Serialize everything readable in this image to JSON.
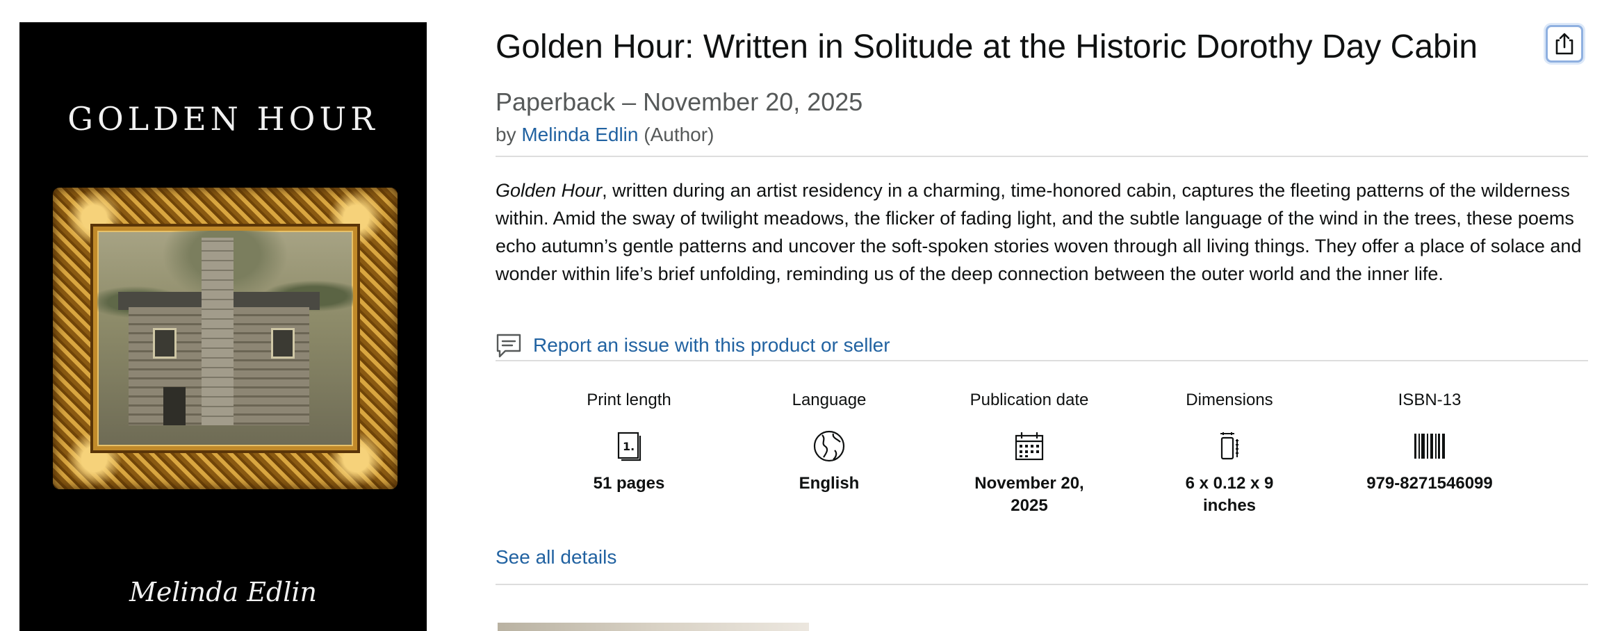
{
  "cover": {
    "title": "GOLDEN HOUR",
    "author_signature": "Melinda Edlin"
  },
  "product": {
    "title": "Golden Hour: Written in Solitude at the Historic Dorothy Day Cabin",
    "format": "Paperback – November 20, 2025",
    "by_prefix": "by ",
    "author_name": "Melinda Edlin",
    "author_role": " (Author)",
    "description_italic": "Golden Hour",
    "description_rest": ", written during an artist residency in a charming, time-honored cabin, captures the fleeting patterns of the wilderness within. Amid the sway of twilight meadows, the flicker of fading light, and the subtle language of the wind in the trees, these poems echo autumn’s gentle patterns and uncover the soft-spoken stories woven through all living things. They offer a place of solace and wonder within life’s brief unfolding, reminding us of the deep connection between the outer world and the inner life.",
    "report_link": "Report an issue with this product or seller",
    "see_all_details": "See all details"
  },
  "details": [
    {
      "label": "Print length",
      "icon": "book-pages-icon",
      "value": "51 pages"
    },
    {
      "label": "Language",
      "icon": "globe-icon",
      "value": "English"
    },
    {
      "label": "Publication date",
      "icon": "calendar-icon",
      "value": "November 20, 2025"
    },
    {
      "label": "Dimensions",
      "icon": "dimensions-icon",
      "value": "6 x 0.12 x 9 inches"
    },
    {
      "label": "ISBN-13",
      "icon": "barcode-icon",
      "value": "979-8271546099"
    }
  ],
  "colors": {
    "link": "#2162a1",
    "text": "#0f1111",
    "muted": "#565959",
    "divider": "#dddddd",
    "share_focus": "#8fb0e0"
  }
}
